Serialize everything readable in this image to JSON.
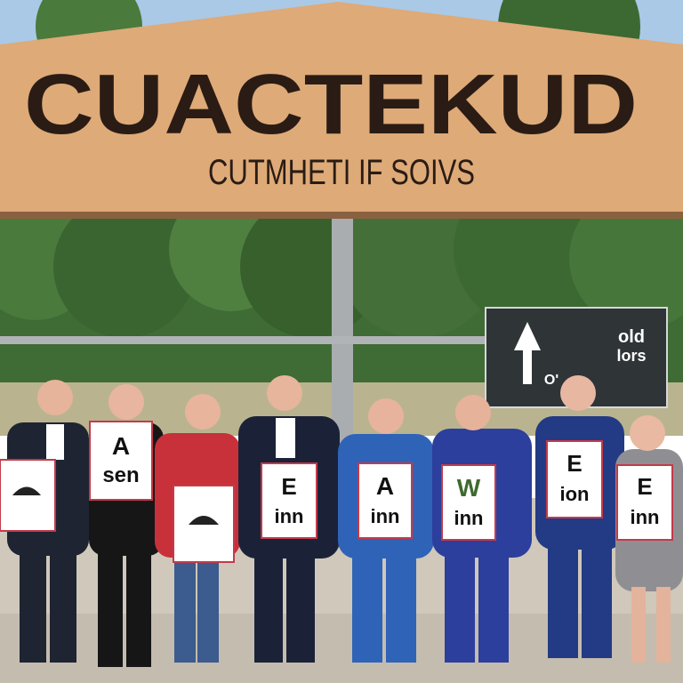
{
  "banner": {
    "headline": "CUACTEKUD",
    "subline": "CUTMHETI IF SOIVS"
  },
  "direction_sign": {
    "arrow": "up-arrow-icon",
    "text_top": "old",
    "text_mid": "lors",
    "text_bottom": "O'"
  },
  "placards": [
    {
      "line1": "",
      "line2": ""
    },
    {
      "line1": "A",
      "line2": "sen"
    },
    {
      "line1": "",
      "line2": ""
    },
    {
      "line1": "E",
      "line2": "inn"
    },
    {
      "line1": "A",
      "line2": "inn"
    },
    {
      "line1": "W",
      "line2": "inn"
    },
    {
      "line1": "E",
      "line2": "ion"
    },
    {
      "line1": "E",
      "line2": "inn"
    }
  ],
  "colors": {
    "sky": "#aac9e6",
    "banner": "#deaa78",
    "banner_text": "#2a1c14",
    "trees": "#3f6b34",
    "ground": "#cfc8bb",
    "sign": "#2f3437"
  }
}
